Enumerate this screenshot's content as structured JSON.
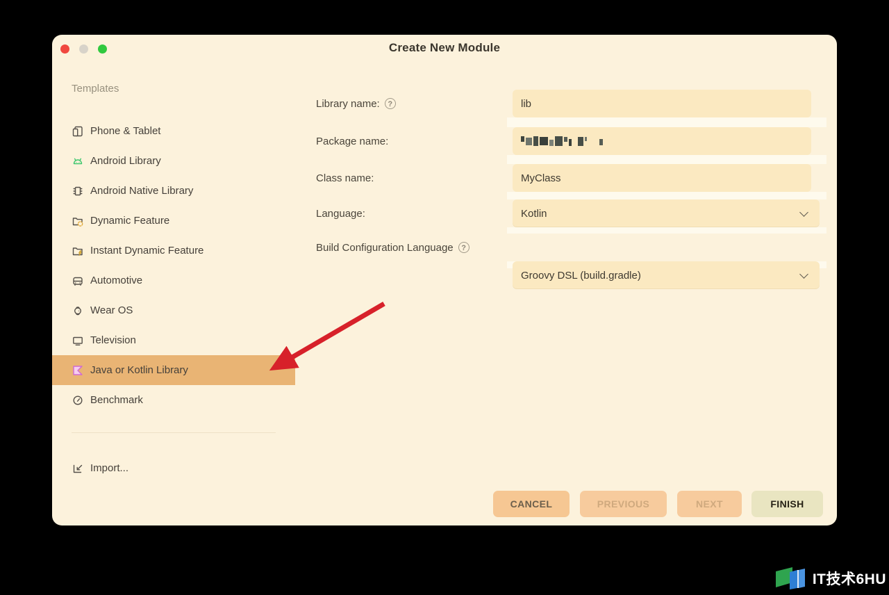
{
  "window": {
    "title": "Create New Module"
  },
  "sidebar": {
    "heading": "Templates",
    "items": [
      {
        "label": "Phone & Tablet",
        "icon": "phone-tablet-icon",
        "selected": false
      },
      {
        "label": "Android Library",
        "icon": "android-icon",
        "selected": false
      },
      {
        "label": "Android Native Library",
        "icon": "chip-icon",
        "selected": false
      },
      {
        "label": "Dynamic Feature",
        "icon": "folder-refresh-icon",
        "selected": false
      },
      {
        "label": "Instant Dynamic Feature",
        "icon": "folder-bolt-icon",
        "selected": false
      },
      {
        "label": "Automotive",
        "icon": "car-icon",
        "selected": false
      },
      {
        "label": "Wear OS",
        "icon": "watch-icon",
        "selected": false
      },
      {
        "label": "Television",
        "icon": "tv-icon",
        "selected": false
      },
      {
        "label": "Java or Kotlin Library",
        "icon": "kotlin-icon",
        "selected": true
      },
      {
        "label": "Benchmark",
        "icon": "gauge-icon",
        "selected": false
      }
    ],
    "import_label": "Import..."
  },
  "form": {
    "library_name": {
      "label": "Library name:",
      "has_help": true,
      "value": "lib"
    },
    "package_name": {
      "label": "Package name:",
      "redacted": true
    },
    "class_name": {
      "label": "Class name:",
      "value": "MyClass"
    },
    "language": {
      "label": "Language:",
      "value": "Kotlin"
    },
    "build_config": {
      "label": "Build Configuration Language",
      "has_help": true,
      "value": "Groovy DSL (build.gradle)"
    }
  },
  "buttons": {
    "cancel": {
      "label": "CANCEL",
      "enabled": true
    },
    "previous": {
      "label": "PREVIOUS",
      "enabled": false
    },
    "next": {
      "label": "NEXT",
      "enabled": false
    },
    "finish": {
      "label": "FINISH",
      "enabled": true
    }
  },
  "annotation": {
    "type": "red-arrow",
    "points_to": "Java or Kotlin Library",
    "color": "#d7212a"
  },
  "watermark": {
    "text": "IT技术6HU"
  },
  "glyphs": {
    "help": "?"
  },
  "colors": {
    "page_bg": "#000000",
    "window_bg": "#fcf2dc",
    "field_bg": "#fbe9c1",
    "selected_row_bg": "#e9b474",
    "cancel_button_bg": "#f6c793",
    "disabled_button_bg": "#f7cb9d",
    "finish_button_bg": "#e9e5c1",
    "traffic_close": "#f0483f",
    "traffic_minimize": "#d8d3c9",
    "traffic_zoom": "#30c93f",
    "text_primary": "#45403a",
    "text_secondary": "#98917f"
  }
}
